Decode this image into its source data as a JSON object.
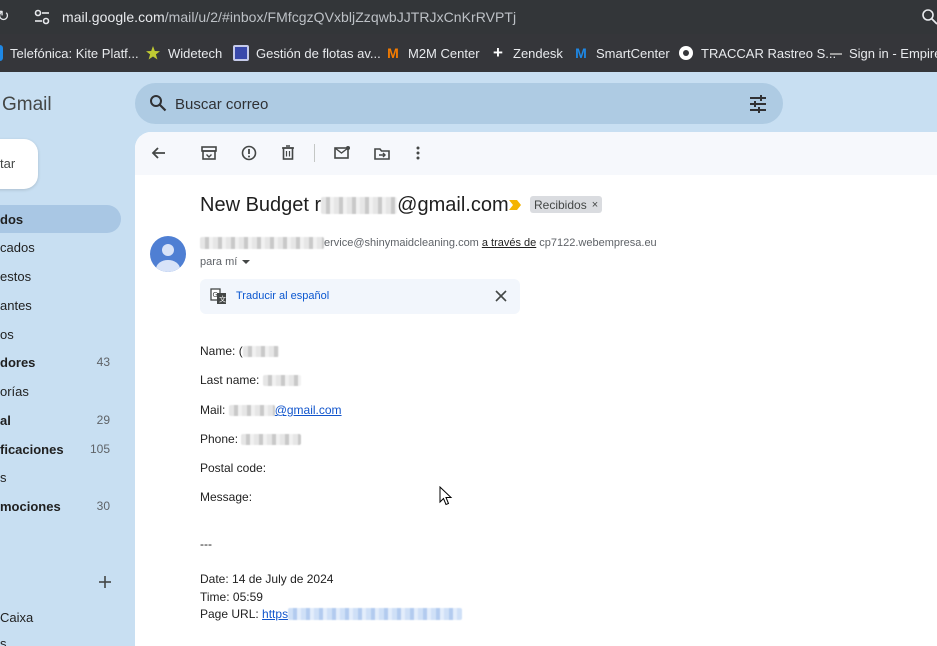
{
  "browser": {
    "url_host": "mail.google.com",
    "url_path": "/mail/u/2/#inbox/FMfcgzQVxbljZzqwbJJTRJxCnKrRVPTj",
    "bookmarks": [
      {
        "label": "Telefónica: Kite Platf...",
        "icon": "telefonica-icon",
        "color": "#1e88e5"
      },
      {
        "label": "Widetech",
        "icon": "star-icon",
        "color": "#c0ca33"
      },
      {
        "label": "Gestión de flotas av...",
        "icon": "fleet-icon",
        "color": "#3949ab"
      },
      {
        "label": "M2M Center",
        "icon": "m2m-icon",
        "color": "#f57c00"
      },
      {
        "label": "Zendesk",
        "icon": "zendesk-icon",
        "color": "#ffffff"
      },
      {
        "label": "SmartCenter",
        "icon": "movistar-icon",
        "color": "#1e88e5"
      },
      {
        "label": "TRACCAR Rastreo S...",
        "icon": "traccar-icon",
        "color": "#ffffff"
      },
      {
        "label": "Sign in - Empire",
        "icon": "empire-icon",
        "color": "#9e9e9e"
      }
    ]
  },
  "gmail": {
    "logo": "Gmail",
    "search_placeholder": "Buscar correo",
    "compose_label": "tar",
    "nav": [
      {
        "label": "dos",
        "count": "",
        "active": true,
        "bold": true
      },
      {
        "label": "cados",
        "count": "",
        "active": false,
        "bold": false
      },
      {
        "label": "estos",
        "count": "",
        "active": false,
        "bold": false
      },
      {
        "label": "antes",
        "count": "",
        "active": false,
        "bold": false
      },
      {
        "label": "os",
        "count": "",
        "active": false,
        "bold": false
      },
      {
        "label": "dores",
        "count": "43",
        "active": false,
        "bold": true
      },
      {
        "label": "orías",
        "count": "",
        "active": false,
        "bold": false
      },
      {
        "label": "al",
        "count": "29",
        "active": false,
        "bold": true
      },
      {
        "label": "ficaciones",
        "count": "105",
        "active": false,
        "bold": true
      },
      {
        "label": "s",
        "count": "",
        "active": false,
        "bold": false
      },
      {
        "label": "mociones",
        "count": "30",
        "active": false,
        "bold": true
      }
    ],
    "label_item": "Caixa",
    "tail_item": "s"
  },
  "email": {
    "subject_start": "New Budget r",
    "subject_end": "@gmail.com",
    "label_chip": "Recibidos",
    "sender_email_suffix": "ervice@shinymaidcleaning.com",
    "via_text": "a través de",
    "via_domain": "cp7122.webempresa.eu",
    "to_text": "para mí",
    "translate_label": "Traducir al español",
    "fields": {
      "name_label": "Name:",
      "name_prefix": "(",
      "lastname_label": "Last name:",
      "mail_label": "Mail:",
      "mail_suffix": "@gmail.com",
      "phone_label": "Phone:",
      "postal_label": "Postal code:",
      "message_label": "Message:",
      "separator": "---",
      "date_label": "Date:",
      "date_value": "14 de July de 2024",
      "time_label": "Time:",
      "time_value": "05:59",
      "url_label": "Page URL:",
      "url_prefix": "https"
    }
  },
  "colors": {
    "app_background": "#c8dff2",
    "search_background": "#aecbe3",
    "link": "#1155cc",
    "avatar": "#4f7fd3"
  }
}
